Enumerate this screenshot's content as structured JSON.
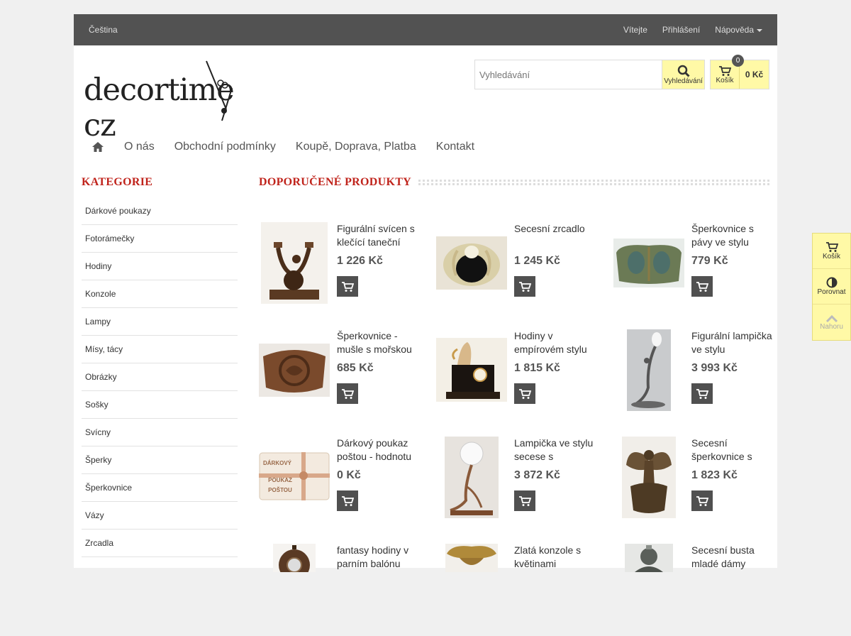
{
  "topbar": {
    "language": "Čeština",
    "links": [
      "Vítejte",
      "Přihlášení"
    ],
    "help": "Nápověda"
  },
  "logo": {
    "text": "decortime",
    "suffix": "cz"
  },
  "search": {
    "placeholder": "Vyhledávání",
    "button_label": "Vyhledávání"
  },
  "cart": {
    "label": "Košík",
    "count": "0",
    "total": "0 Kč"
  },
  "nav": {
    "items": [
      "O nás",
      "Obchodní podmínky",
      "Koupě, Doprava, Platba",
      "Kontakt"
    ]
  },
  "sidebar": {
    "title": "KATEGORIE",
    "categories": [
      "Dárkové poukazy",
      "Fotorámečky",
      "Hodiny",
      "Konzole",
      "Lampy",
      "Mísy, tácy",
      "Obrázky",
      "Sošky",
      "Svícny",
      "Šperky",
      "Šperkovnice",
      "Vázy",
      "Zrcadla"
    ]
  },
  "main": {
    "title": "DOPORUČENÉ PRODUKTY",
    "products": [
      {
        "name": "Figurální svícen s klečící taneční",
        "price": "1 226 Kč",
        "icon": "candlestick-image"
      },
      {
        "name": "Secesní zrcadlo",
        "price": "1 245 Kč",
        "icon": "mirror-image"
      },
      {
        "name": "Šperkovnice s pávy ve stylu",
        "price": "779 Kč",
        "icon": "jewelry-box-image"
      },
      {
        "name": "Šperkovnice - mušle s mořskou",
        "price": "685 Kč",
        "icon": "shell-box-image"
      },
      {
        "name": "Hodiny v empírovém stylu",
        "price": "1 815 Kč",
        "icon": "clock-image"
      },
      {
        "name": "Figurální lampička ve stylu",
        "price": "3 993 Kč",
        "icon": "lamp-image"
      },
      {
        "name": "Dárkový poukaz poštou - hodnotu",
        "price": "0 Kč",
        "icon": "voucher-image"
      },
      {
        "name": "Lampička ve stylu secese s",
        "price": "3 872 Kč",
        "icon": "lamp-image"
      },
      {
        "name": "Secesní šperkovnice s",
        "price": "1 823 Kč",
        "icon": "fairy-box-image"
      },
      {
        "name": "fantasy hodiny v parním balónu",
        "price": "",
        "icon": "balloon-clock-image"
      },
      {
        "name": "Zlatá konzole s květinami",
        "price": "",
        "icon": "console-image"
      },
      {
        "name": "Secesní busta mladé dámy",
        "price": "",
        "icon": "bust-image"
      }
    ],
    "voucher_text": [
      "DÁRKOVÝ",
      "POUKAZ",
      "POŠTOU"
    ]
  },
  "float_panel": {
    "items": [
      "Košík",
      "Porovnat",
      "Nahoru"
    ]
  },
  "colors": {
    "accent_red": "#c0241c",
    "topbar": "#525252",
    "yellow": "#fff9a6",
    "button": "#505050"
  }
}
